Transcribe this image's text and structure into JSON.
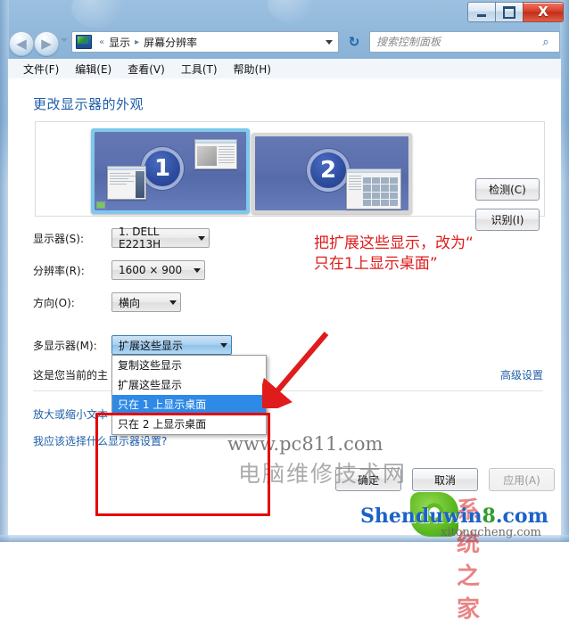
{
  "window": {
    "controls": {
      "minimize": "–",
      "maximize": "□",
      "close": "X"
    }
  },
  "nav": {
    "back_glyph": "◀",
    "forward_glyph": "▶",
    "refresh_glyph": "↻",
    "breadcrumb": {
      "chevron": "«",
      "root": "显示",
      "separator": "▸",
      "current": "屏幕分辨率"
    },
    "search": {
      "placeholder": "搜索控制面板",
      "value": "",
      "icon": "⌕"
    }
  },
  "menubar": {
    "items": [
      {
        "label": "文件(F)"
      },
      {
        "label": "编辑(E)"
      },
      {
        "label": "查看(V)"
      },
      {
        "label": "工具(T)"
      },
      {
        "label": "帮助(H)"
      }
    ]
  },
  "page": {
    "title": "更改显示器的外观"
  },
  "preview": {
    "monitor1": {
      "number": "1",
      "selected": true
    },
    "monitor2": {
      "number": "2",
      "selected": false
    },
    "detect_button": "检测(C)",
    "identify_button": "识别(I)"
  },
  "form": {
    "monitor": {
      "label": "显示器(S):",
      "value": "1. DELL E2213H"
    },
    "resolution": {
      "label": "分辨率(R):",
      "value": "1600 × 900"
    },
    "orientation": {
      "label": "方向(O):",
      "value": "横向"
    },
    "multi": {
      "label": "多显示器(M):",
      "value": "扩展这些显示"
    }
  },
  "dropdown": {
    "open": true,
    "options": [
      {
        "label": "复制这些显示",
        "selected": false
      },
      {
        "label": "扩展这些显示",
        "selected": false
      },
      {
        "label": "只在 1 上显示桌面",
        "selected": true
      },
      {
        "label": "只在 2 上显示桌面",
        "selected": false
      }
    ]
  },
  "info": {
    "current_main": "这是您当前的主",
    "advanced_link": "高级设置",
    "text_size_link": "放大或缩小文本",
    "which_settings_link": "我应该选择什么显示器设置?"
  },
  "buttons": {
    "ok": "确定",
    "cancel": "取消",
    "apply": "应用(A)"
  },
  "annotation": {
    "text": "把扩展这些显示，改为“\n只在1上显示桌面”",
    "color": "#e01b1b"
  },
  "watermarks": {
    "mid_url": "www.pc811.com",
    "mid_cn": "电脑维修技术网",
    "bottom_main_a": "Shenduwin",
    "bottom_main_b": "8",
    "bottom_main_c": ".com",
    "bottom_sub": "xitongcheng.com",
    "bottom_red": "系统之家"
  }
}
